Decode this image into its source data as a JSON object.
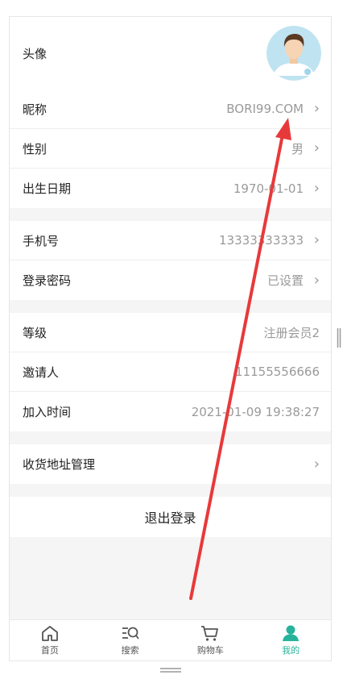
{
  "profile": {
    "avatar": {
      "label": "头像"
    },
    "group1": [
      {
        "label": "昵称",
        "value": "BORI99.COM",
        "chevron": true
      },
      {
        "label": "性别",
        "value": "男",
        "chevron": true
      },
      {
        "label": "出生日期",
        "value": "1970-01-01",
        "chevron": true
      }
    ],
    "group2": [
      {
        "label": "手机号",
        "value": "13333333333",
        "chevron": true
      },
      {
        "label": "登录密码",
        "value": "已设置",
        "chevron": true
      }
    ],
    "group3": [
      {
        "label": "等级",
        "value": "注册会员2",
        "chevron": false
      },
      {
        "label": "邀请人",
        "value": "11155556666",
        "chevron": false
      },
      {
        "label": "加入时间",
        "value": "2021-01-09 19:38:27",
        "chevron": false
      }
    ],
    "group4": [
      {
        "label": "收货地址管理",
        "value": "",
        "chevron": true
      }
    ],
    "logout_label": "退出登录"
  },
  "tabbar": {
    "tabs": [
      {
        "label": "首页",
        "icon": "home-icon",
        "active": false
      },
      {
        "label": "搜索",
        "icon": "search-icon",
        "active": false
      },
      {
        "label": "购物车",
        "icon": "cart-icon",
        "active": false
      },
      {
        "label": "我的",
        "icon": "user-icon",
        "active": true
      }
    ]
  },
  "colors": {
    "accent": "#27b39b",
    "annotation_arrow": "#e8393a"
  }
}
